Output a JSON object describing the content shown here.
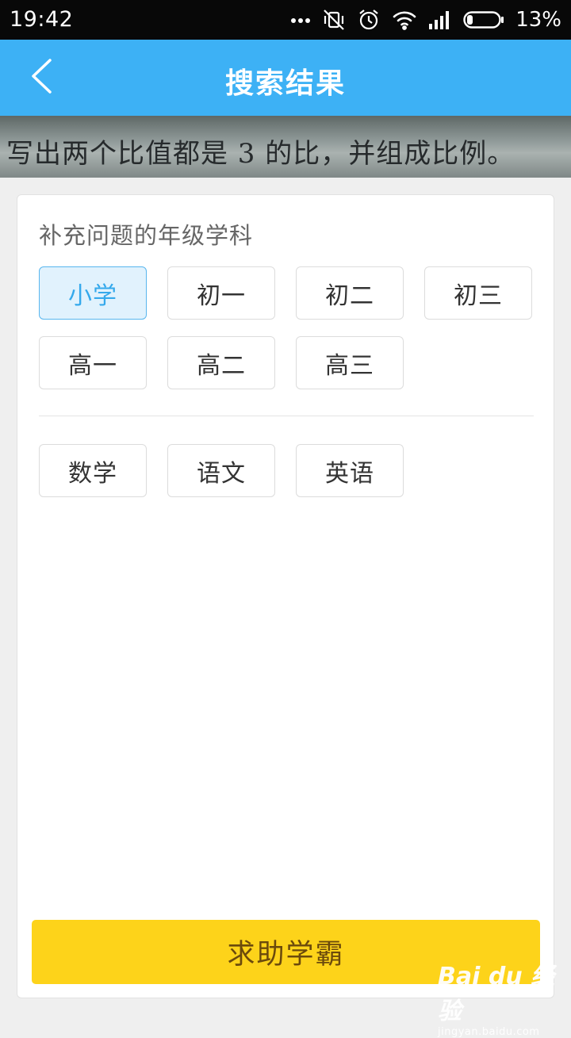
{
  "status_bar": {
    "time": "19:42",
    "battery_percent": "13%",
    "icons": [
      "more-dots-icon",
      "vibrate-off-icon",
      "alarm-icon",
      "wifi-icon",
      "signal-icon",
      "battery-icon"
    ]
  },
  "navbar": {
    "back_icon": "chevron-left-icon",
    "title": "搜索结果"
  },
  "question_image": {
    "text": "写出两个比值都是 3 的比，并组成比例。"
  },
  "panel": {
    "heading": "补充问题的年级学科",
    "grades": [
      {
        "label": "小学",
        "selected": true
      },
      {
        "label": "初一",
        "selected": false
      },
      {
        "label": "初二",
        "selected": false
      },
      {
        "label": "初三",
        "selected": false
      },
      {
        "label": "高一",
        "selected": false
      },
      {
        "label": "高二",
        "selected": false
      },
      {
        "label": "高三",
        "selected": false
      }
    ],
    "subjects": [
      {
        "label": "数学",
        "selected": false
      },
      {
        "label": "语文",
        "selected": false
      },
      {
        "label": "英语",
        "selected": false
      }
    ],
    "submit_label": "求助学霸"
  },
  "watermark": {
    "brand": "Bai du 经验",
    "url": "jingyan.baidu.com"
  },
  "colors": {
    "navbar": "#3db1f5",
    "selected_chip_bg": "#e1f2fd",
    "selected_chip_text": "#35a9ec",
    "submit_bg": "#fdd31a",
    "submit_text": "#6b4a0c"
  }
}
